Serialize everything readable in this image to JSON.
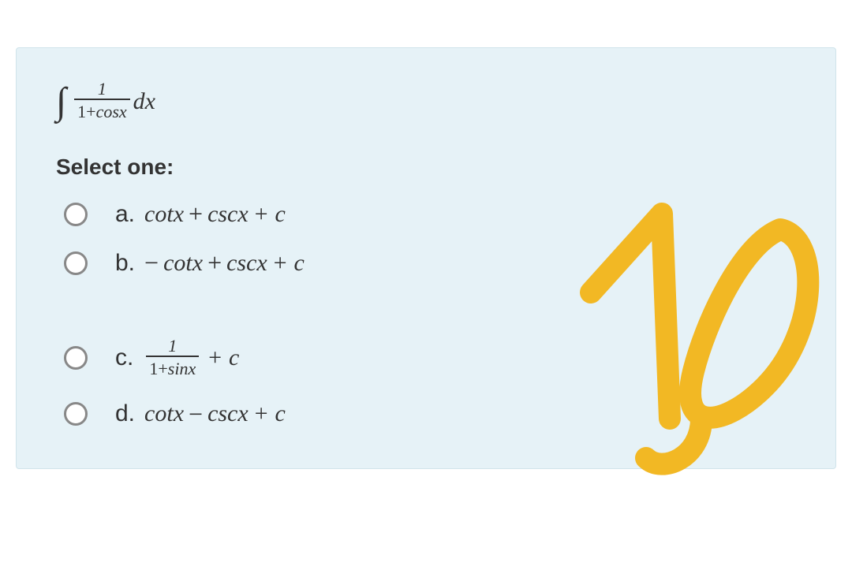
{
  "question": {
    "integral_num": "1",
    "integral_den_pre": "1+",
    "integral_den_fn": "cos",
    "integral_den_var": "x",
    "dx_d": "d",
    "dx_x": "x"
  },
  "prompt": "Select one:",
  "options": {
    "a": {
      "letter": "a.",
      "pre": "cot",
      "mid": " + ",
      "fn2": "csc",
      "tail": " + c",
      "var": "x"
    },
    "b": {
      "letter": "b.",
      "neg": "−",
      "pre": "cot",
      "mid": " + ",
      "fn2": "csc",
      "tail": " + c",
      "var": "x"
    },
    "c": {
      "letter": "c.",
      "frac_num": "1",
      "frac_den_pre": "1+",
      "frac_den_fn": "sin",
      "frac_den_var": "x",
      "tail": " + c"
    },
    "d": {
      "letter": "d.",
      "pre": "cot",
      "mid": " − ",
      "fn2": "csc",
      "tail": " + c",
      "var": "x"
    }
  },
  "annotation": "10"
}
